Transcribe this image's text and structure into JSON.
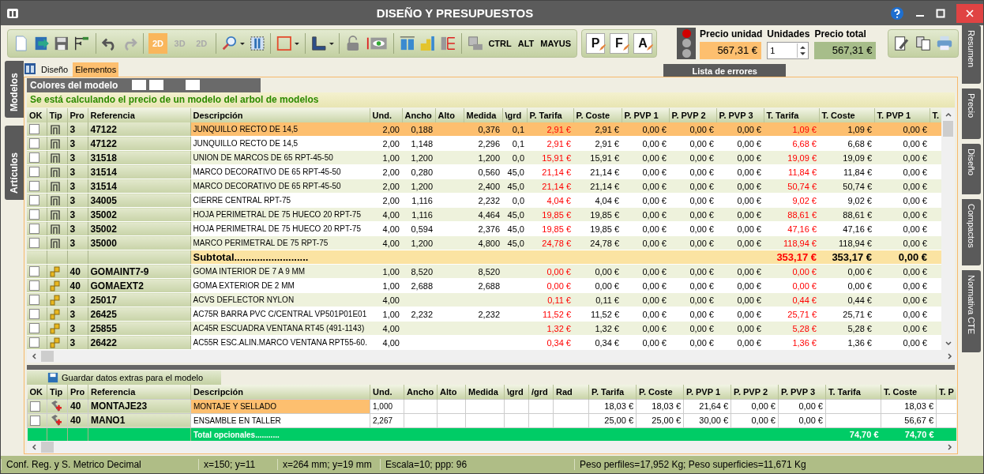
{
  "window": {
    "title": "DISEÑO Y PRESUPUESTOS"
  },
  "toolbar": {
    "view_modes": [
      {
        "label": "2D",
        "selected": true,
        "disabled": false
      },
      {
        "label": "3D",
        "selected": false,
        "disabled": true
      },
      {
        "label": "2D",
        "selected": false,
        "disabled": true
      }
    ],
    "modifier_keys": [
      "CTRL",
      "ALT",
      "MAYUS"
    ],
    "document_tools": [
      "P",
      "F",
      "A"
    ]
  },
  "error_lights": [
    {
      "on": true
    },
    {
      "on": false
    },
    {
      "on": false
    }
  ],
  "price": {
    "unit_label": "Precio unidad",
    "unit_value": "567,31 €",
    "units_label": "Unidades",
    "units_value": "1",
    "total_label": "Precio total",
    "total_value": "567,31 €"
  },
  "errors_button": "Lista de errores",
  "left_tabs": [
    "Modelos",
    "Artículos"
  ],
  "right_tabs": [
    "Resumen",
    "Precio",
    "Diseño",
    "Compactos",
    "Normativa CTE"
  ],
  "view_tabs": [
    {
      "label": "Diseño",
      "selected": false
    },
    {
      "label": "Elementos",
      "selected": true
    }
  ],
  "model_colors": {
    "label": "Colores del modelo"
  },
  "notice": "Se está calculando el precio de un modelo del arbol de modelos",
  "main_table": {
    "columns": [
      {
        "label": "OK",
        "kind": "check"
      },
      {
        "label": "Tip",
        "kind": "icon"
      },
      {
        "label": "Pro",
        "kind": "code"
      },
      {
        "label": "Referencia",
        "kind": "code"
      },
      {
        "label": "Descripción",
        "kind": "text"
      },
      {
        "label": "Und.",
        "kind": "num"
      },
      {
        "label": "Ancho",
        "kind": "num"
      },
      {
        "label": "Alto",
        "kind": "num"
      },
      {
        "label": "Medida",
        "kind": "num"
      },
      {
        "label": "\\grd",
        "kind": "num"
      },
      {
        "label": "P. Tarifa",
        "kind": "tarifa"
      },
      {
        "label": "P. Coste",
        "kind": "num"
      },
      {
        "label": "P. PVP 1",
        "kind": "num"
      },
      {
        "label": "P. PVP 2",
        "kind": "num"
      },
      {
        "label": "P. PVP 3",
        "kind": "num"
      },
      {
        "label": "T. Tarifa",
        "kind": "tarifa"
      },
      {
        "label": "T. Coste",
        "kind": "num"
      },
      {
        "label": "T. PVP 1",
        "kind": "num"
      },
      {
        "label": "T.",
        "kind": "num"
      }
    ],
    "rows": [
      {
        "kind": "profile",
        "selected": true,
        "checked": false,
        "cells": [
          "",
          "",
          "3",
          "47122",
          "JUNQUILLO RECTO DE 14,5",
          "2,00",
          "0,188",
          "",
          "0,376",
          "0,1",
          "2,91 €",
          "2,91 €",
          "0,00 €",
          "0,00 €",
          "0,00 €",
          "1,09 €",
          "1,09 €",
          "0,00 €"
        ]
      },
      {
        "kind": "profile",
        "selected": false,
        "checked": false,
        "cells": [
          "",
          "",
          "3",
          "47122",
          "JUNQUILLO RECTO DE 14,5",
          "2,00",
          "1,148",
          "",
          "2,296",
          "0,1",
          "2,91 €",
          "2,91 €",
          "0,00 €",
          "0,00 €",
          "0,00 €",
          "6,68 €",
          "6,68 €",
          "0,00 €"
        ]
      },
      {
        "kind": "profile",
        "selected": false,
        "checked": false,
        "cells": [
          "",
          "",
          "3",
          "31518",
          "UNION DE MARCOS DE 65 RPT-45-50",
          "1,00",
          "1,200",
          "",
          "1,200",
          "0,0",
          "15,91 €",
          "15,91 €",
          "0,00 €",
          "0,00 €",
          "0,00 €",
          "19,09 €",
          "19,09 €",
          "0,00 €"
        ]
      },
      {
        "kind": "profile",
        "selected": false,
        "checked": false,
        "cells": [
          "",
          "",
          "3",
          "31514",
          "MARCO DECORATIVO DE 65 RPT-45-50",
          "2,00",
          "0,280",
          "",
          "0,560",
          "45,0",
          "21,14 €",
          "21,14 €",
          "0,00 €",
          "0,00 €",
          "0,00 €",
          "11,84 €",
          "11,84 €",
          "0,00 €"
        ]
      },
      {
        "kind": "profile",
        "selected": false,
        "checked": false,
        "cells": [
          "",
          "",
          "3",
          "31514",
          "MARCO DECORATIVO DE 65 RPT-45-50",
          "2,00",
          "1,200",
          "",
          "2,400",
          "45,0",
          "21,14 €",
          "21,14 €",
          "0,00 €",
          "0,00 €",
          "0,00 €",
          "50,74 €",
          "50,74 €",
          "0,00 €"
        ]
      },
      {
        "kind": "profile",
        "selected": false,
        "checked": false,
        "cells": [
          "",
          "",
          "3",
          "34005",
          "CIERRE CENTRAL RPT-75",
          "2,00",
          "1,116",
          "",
          "2,232",
          "0,0",
          "4,04 €",
          "4,04 €",
          "0,00 €",
          "0,00 €",
          "0,00 €",
          "9,02 €",
          "9,02 €",
          "0,00 €"
        ]
      },
      {
        "kind": "profile",
        "selected": false,
        "checked": false,
        "cells": [
          "",
          "",
          "3",
          "35002",
          "HOJA PERIMETRAL DE 75 HUECO 20 RPT-75",
          "4,00",
          "1,116",
          "",
          "4,464",
          "45,0",
          "19,85 €",
          "19,85 €",
          "0,00 €",
          "0,00 €",
          "0,00 €",
          "88,61 €",
          "88,61 €",
          "0,00 €"
        ]
      },
      {
        "kind": "profile",
        "selected": false,
        "checked": false,
        "cells": [
          "",
          "",
          "3",
          "35002",
          "HOJA PERIMETRAL DE 75 HUECO 20 RPT-75",
          "4,00",
          "0,594",
          "",
          "2,376",
          "45,0",
          "19,85 €",
          "19,85 €",
          "0,00 €",
          "0,00 €",
          "0,00 €",
          "47,16 €",
          "47,16 €",
          "0,00 €"
        ]
      },
      {
        "kind": "profile",
        "selected": false,
        "checked": false,
        "cells": [
          "",
          "",
          "3",
          "35000",
          "MARCO PERIMETRAL DE 75 RPT-75",
          "4,00",
          "1,200",
          "",
          "4,800",
          "45,0",
          "24,78 €",
          "24,78 €",
          "0,00 €",
          "0,00 €",
          "0,00 €",
          "118,94 €",
          "118,94 €",
          "0,00 €"
        ]
      },
      {
        "kind": "subtotal",
        "cells": [
          "",
          "",
          "",
          "",
          "Subtotal..........................",
          "",
          "",
          "",
          "",
          "",
          "",
          "",
          "",
          "",
          "",
          "353,17 €",
          "353,17 €",
          "0,00 €"
        ]
      },
      {
        "kind": "accessory",
        "selected": false,
        "checked": false,
        "cells": [
          "",
          "",
          "40",
          "GOMAINT7-9",
          "GOMA INTERIOR DE 7 A 9 MM",
          "1,00",
          "8,520",
          "",
          "8,520",
          "",
          "0,00 €",
          "0,00 €",
          "0,00 €",
          "0,00 €",
          "0,00 €",
          "0,00 €",
          "0,00 €",
          "0,00 €"
        ]
      },
      {
        "kind": "accessory",
        "selected": false,
        "checked": false,
        "cells": [
          "",
          "",
          "40",
          "GOMAEXT2",
          "GOMA EXTERIOR DE 2 MM",
          "1,00",
          "2,688",
          "",
          "2,688",
          "",
          "0,00 €",
          "0,00 €",
          "0,00 €",
          "0,00 €",
          "0,00 €",
          "0,00 €",
          "0,00 €",
          "0,00 €"
        ]
      },
      {
        "kind": "accessory",
        "selected": false,
        "checked": false,
        "cells": [
          "",
          "",
          "3",
          "25017",
          "ACVS DEFLECTOR NYLON",
          "4,00",
          "",
          "",
          "",
          "",
          "0,11 €",
          "0,11 €",
          "0,00 €",
          "0,00 €",
          "0,00 €",
          "0,44 €",
          "0,44 €",
          "0,00 €"
        ]
      },
      {
        "kind": "accessory",
        "selected": false,
        "checked": false,
        "cells": [
          "",
          "",
          "3",
          "26425",
          "AC75R BARRA PVC C/CENTRAL VP501P01E01",
          "1,00",
          "2,232",
          "",
          "2,232",
          "",
          "11,52 €",
          "11,52 €",
          "0,00 €",
          "0,00 €",
          "0,00 €",
          "25,71 €",
          "25,71 €",
          "0,00 €"
        ]
      },
      {
        "kind": "accessory",
        "selected": false,
        "checked": false,
        "cells": [
          "",
          "",
          "3",
          "25855",
          "AC45R ESCUADRA VENTANA RT45 (491-1143)",
          "4,00",
          "",
          "",
          "",
          "",
          "1,32 €",
          "1,32 €",
          "0,00 €",
          "0,00 €",
          "0,00 €",
          "5,28 €",
          "5,28 €",
          "0,00 €"
        ]
      },
      {
        "kind": "accessory",
        "selected": false,
        "checked": false,
        "cells": [
          "",
          "",
          "3",
          "26422",
          "AC55R ESC.ALIN.MARCO VENTANA RPT55-60.",
          "4,00",
          "",
          "",
          "",
          "",
          "0,34 €",
          "0,34 €",
          "0,00 €",
          "0,00 €",
          "0,00 €",
          "1,36 €",
          "1,36 €",
          "0,00 €"
        ]
      }
    ]
  },
  "save_extras_button": "Guardar datos extras para el modelo",
  "extras_table": {
    "columns": [
      {
        "label": "OK",
        "kind": "check"
      },
      {
        "label": "Tip",
        "kind": "icon"
      },
      {
        "label": "Pro",
        "kind": "code"
      },
      {
        "label": "Referencia",
        "kind": "code"
      },
      {
        "label": "Descripción",
        "kind": "text"
      },
      {
        "label": "Und.",
        "kind": "text"
      },
      {
        "label": "Ancho",
        "kind": "num"
      },
      {
        "label": "Alto",
        "kind": "num"
      },
      {
        "label": "Medida",
        "kind": "num"
      },
      {
        "label": "\\grd",
        "kind": "num"
      },
      {
        "label": "/grd",
        "kind": "num"
      },
      {
        "label": "Rad",
        "kind": "num"
      },
      {
        "label": "P. Tarifa",
        "kind": "num"
      },
      {
        "label": "P. Coste",
        "kind": "num"
      },
      {
        "label": "P. PVP 1",
        "kind": "num"
      },
      {
        "label": "P. PVP 2",
        "kind": "num"
      },
      {
        "label": "P. PVP 3",
        "kind": "num"
      },
      {
        "label": "T. Tarifa",
        "kind": "num"
      },
      {
        "label": "T. Coste",
        "kind": "num"
      },
      {
        "label": "T. P",
        "kind": "num"
      }
    ],
    "rows": [
      {
        "kind": "labor",
        "selected": true,
        "checked": false,
        "cells": [
          "",
          "",
          "40",
          "MONTAJE23",
          "MONTAJE Y SELLADO",
          "1,000",
          "",
          "",
          "",
          "",
          "",
          "",
          "18,03 €",
          "18,03 €",
          "21,64 €",
          "0,00 €",
          "0,00 €",
          "",
          "18,03 €"
        ]
      },
      {
        "kind": "labor",
        "selected": false,
        "checked": false,
        "cells": [
          "",
          "",
          "40",
          "MANO1",
          "ENSAMBLE EN TALLER",
          "2,267",
          "",
          "",
          "",
          "",
          "",
          "",
          "25,00 €",
          "25,00 €",
          "30,00 €",
          "0,00 €",
          "0,00 €",
          "",
          "56,67 €"
        ]
      },
      {
        "kind": "total",
        "cells": [
          "",
          "",
          "",
          "",
          "Total opcionales...........",
          "",
          "",
          "",
          "",
          "",
          "",
          "",
          "",
          "",
          "",
          "",
          "",
          "74,70 €",
          "74,70 €"
        ]
      }
    ]
  },
  "status_bar": [
    "Conf. Reg. y S. Metrico Decimal",
    "x=150; y=11",
    "x=264 mm; y=19 mm",
    "Escala=10; ppp: 96",
    "Peso perfiles=17,952 Kg; Peso superficies=11,671 Kg"
  ]
}
